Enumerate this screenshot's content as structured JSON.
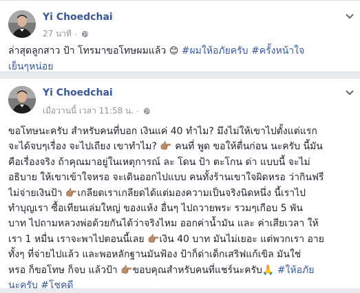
{
  "post1": {
    "author": "Yi Choedchai",
    "time": "27 นาที",
    "dot": "·",
    "lines": [
      {
        "text": "ล่าสุดลูกสาว ป้า โทรมาขอโทษผมแล้ว ",
        "emoji": "😊",
        "tags": " #ผมให้อภัยครับ #ครั้งหน้าใจ"
      },
      {
        "text": "",
        "emoji": "",
        "tags": "เย็นๆหน่อย"
      }
    ]
  },
  "post2": {
    "author": "Yi Choedchai",
    "time": "เมื่อวานนี้ เวลา 11:58 น.",
    "dot": "·",
    "lines": [
      "ขอโทษนะครับ สำหรับคนที่บอก เงินแค่ 40 ทำไม? มึงไม่ให้เขาไปตั้งแต่แรก",
      "จะได้จบๆเรื่อง จะไปเถียง เขาทำไม? 👉🏽 คนที่ พูด ขอให้ตื่นก่อน นะครับ นี้มัน",
      "คือเรื่องจริง ถ้าคุณมาอยู่ในเหตุการณ์ ละ โดน ป้า ตะโกน ด่า แบบนี้ จะไม่",
      "อธิบาย ให้เขาเข้าใจหรอ จะเดินออกไปแบบ คนทั้งร้านเขาใจผิดหรอ ว่ากินฟรี",
      "ไม่จ่ายเงินป้า 👉🏽เกลียดเราเกลียดได้แต่มองความเป็นจริงนิดหนึ่ง นี้เราไป",
      "ทำบุญเรา ซื้อเทียนเล่มใหญ่ ของแห้ง อื่นๆ ไปถวายพระ รวมๆเกือบ 5 พัน",
      "บาท ไปถามหลวงพ่อด้วยกันได้ว่าจริงไหม ออกค่าน้ำมัน และ ค่าเสียเวลา ให้",
      "เรา 1 หมื่น เราจะพาไปตอนนี้เลย 👉🏽เงิน 40 บาท มันไม่เยอะ แต่พวกเรา อาย",
      "ทั้งๆ ที่จ่ายไปแล้ว และพอหลักฐานมันฟ้อง ป้าก็ด่าเด็กเสริฟแก้เขิล มันใช่",
      "หรอ ก็ขอโทษ ก็จบ แล้วป้า 👉🏽ขอบคุณสำหรับคนที่แชร์นะครับ🙏 "
    ],
    "tag_tail_1": "#ให้อภัย",
    "tag_line_2": "นะครับ #โชคดี"
  },
  "colors": {
    "name": "#385898",
    "hashtag": "#385898",
    "meta": "#90949c",
    "background": "#e9ebee"
  },
  "icons": [
    "avatar",
    "globe-icon",
    "chevron-down-icon"
  ]
}
